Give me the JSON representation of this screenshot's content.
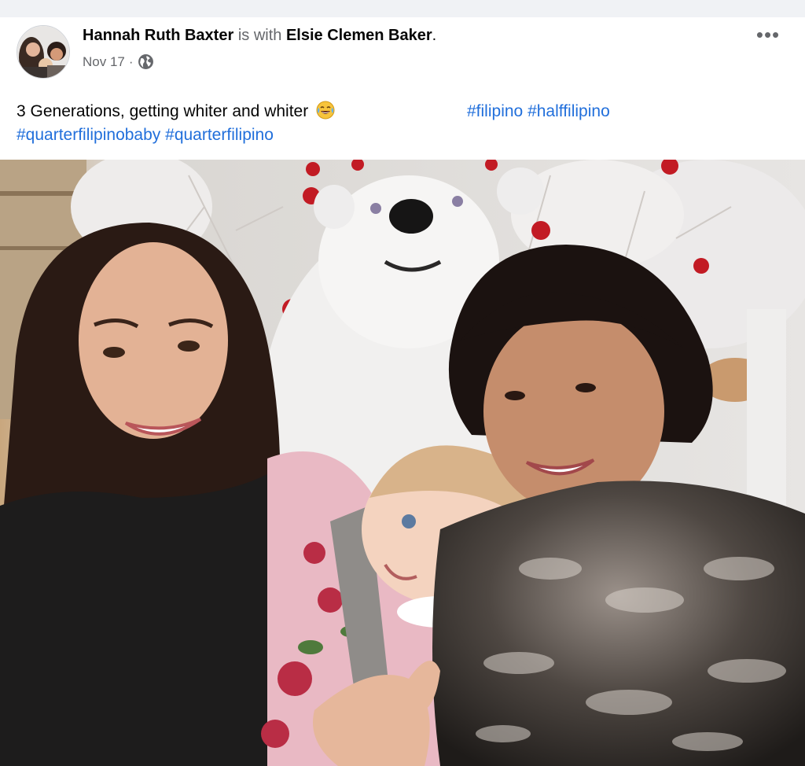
{
  "post": {
    "author": "Hannah Ruth Baxter",
    "with_text": "is with",
    "tagged": "Elsie Clemen Baker",
    "period": ".",
    "date": "Nov 17",
    "separator": "·",
    "privacy_icon": "globe-icon",
    "more_icon": "more-options-icon",
    "more_label": "•••"
  },
  "caption": {
    "text": "3 Generations, getting whiter and whiter",
    "emoji": "face-with-tears-of-joy",
    "hashtags_line1": [
      "#filipino",
      "#halffilipino"
    ],
    "hashtags_line2": [
      "#quarterfilipinobaby",
      "#quarterfilipino"
    ]
  },
  "colors": {
    "link": "#216fdb",
    "secondary_text": "#65676b",
    "primary_text": "#050505"
  }
}
